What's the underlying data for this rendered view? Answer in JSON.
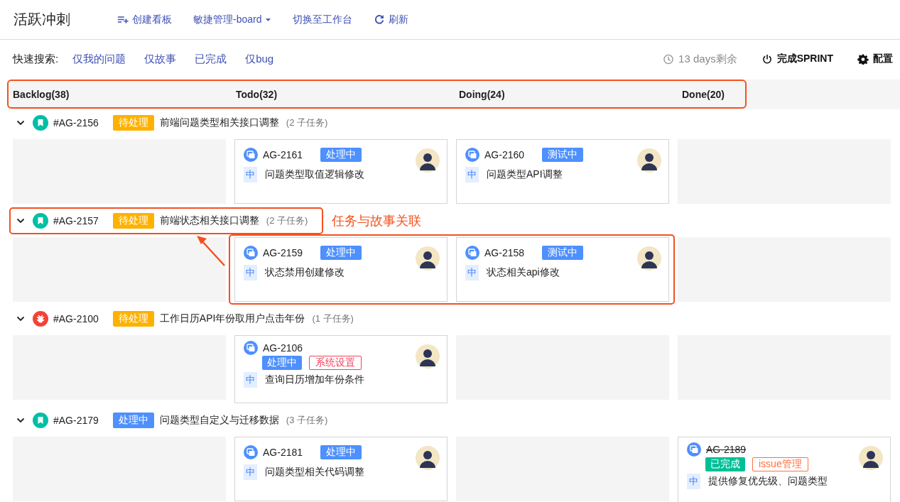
{
  "app_title": "活跃冲刺",
  "nav": [
    {
      "kind": "create",
      "label": "创建看板"
    },
    {
      "kind": "dropdown",
      "label": "敏捷管理-board"
    },
    {
      "kind": "plain",
      "label": "切换至工作台"
    },
    {
      "kind": "refresh",
      "label": "刷新"
    }
  ],
  "quick_search": {
    "label": "快速搜索:",
    "filters": [
      "仅我的问题",
      "仅故事",
      "已完成",
      "仅bug"
    ]
  },
  "sprint_remaining": "13 days剩余",
  "complete_button": "完成SPRINT",
  "settings_button": "配置",
  "columns_bar": {
    "highlighted": true,
    "columns": [
      "Backlog(38)",
      "Todo(32)",
      "Doing(24)",
      "Done(20)"
    ]
  },
  "swimlanes": [
    {
      "kind": "story",
      "key": "#AG-2156",
      "status": {
        "label": "待处理",
        "color": "#ffb100"
      },
      "title": "前端问题类型相关接口调整",
      "subtasks": "(2 子任务)",
      "highlighted": false,
      "cards_highlighted": false,
      "cells": [
        {
          "kind": "empty"
        },
        {
          "kind": "card",
          "key": "AG-2161",
          "status": {
            "label": "处理中",
            "color": "#4d90fe"
          },
          "done": false,
          "priority": "中",
          "summary": "问题类型取值逻辑修改"
        },
        {
          "kind": "card",
          "key": "AG-2160",
          "status": {
            "label": "测试中",
            "color": "#4d90fe"
          },
          "done": false,
          "priority": "中",
          "summary": "问题类型API调整"
        },
        {
          "kind": "empty"
        }
      ]
    },
    {
      "kind": "story",
      "key": "#AG-2157",
      "status": {
        "label": "待处理",
        "color": "#ffb100"
      },
      "title": "前端状态相关接口调整",
      "subtasks": "(2 子任务)",
      "highlighted": true,
      "annotation": "任务与故事关联",
      "cards_highlighted": true,
      "cells": [
        {
          "kind": "empty"
        },
        {
          "kind": "card",
          "key": "AG-2159",
          "status": {
            "label": "处理中",
            "color": "#4d90fe"
          },
          "done": false,
          "priority": "中",
          "summary": "状态禁用创建修改"
        },
        {
          "kind": "card",
          "key": "AG-2158",
          "status": {
            "label": "测试中",
            "color": "#4d90fe"
          },
          "done": false,
          "priority": "中",
          "summary": "状态相关api修改"
        },
        {
          "kind": "empty"
        }
      ]
    },
    {
      "kind": "bug",
      "key": "#AG-2100",
      "status": {
        "label": "待处理",
        "color": "#ffb100"
      },
      "title": "工作日历API年份取用户点击年份",
      "subtasks": "(1 子任务)",
      "highlighted": false,
      "cards_highlighted": false,
      "cells": [
        {
          "kind": "empty"
        },
        {
          "kind": "card",
          "key": "AG-2106",
          "status": {
            "label": "处理中",
            "color": "#4d90fe"
          },
          "done": false,
          "tags": [
            {
              "label": "系统设置",
              "color": "#f0445e"
            }
          ],
          "priority": "中",
          "summary": "查询日历增加年份条件"
        },
        {
          "kind": "empty"
        },
        {
          "kind": "empty"
        }
      ]
    },
    {
      "kind": "story",
      "key": "#AG-2179",
      "status": {
        "label": "处理中",
        "color": "#4d90fe"
      },
      "title": "问题类型自定义与迁移数据",
      "subtasks": "(3 子任务)",
      "highlighted": false,
      "cards_highlighted": false,
      "cells": [
        {
          "kind": "empty"
        },
        {
          "kind": "card",
          "key": "AG-2181",
          "status": {
            "label": "处理中",
            "color": "#4d90fe"
          },
          "done": false,
          "priority": "中",
          "summary": "问题类型相关代码调整"
        },
        {
          "kind": "empty"
        },
        {
          "kind": "card",
          "key": "AG-2189",
          "status": {
            "label": "已完成",
            "color": "#00bf96"
          },
          "done": true,
          "tags": [
            {
              "label": "issue管理",
              "color": "#ff7042"
            }
          ],
          "priority": "中",
          "summary": "提供修复优先级、问题类型"
        }
      ]
    }
  ]
}
